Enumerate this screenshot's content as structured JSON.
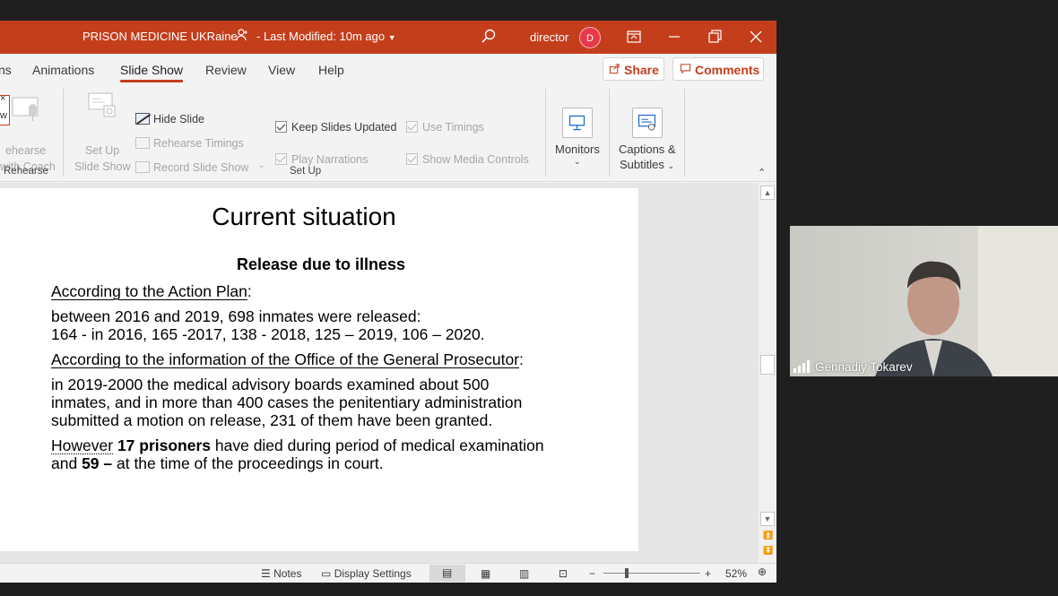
{
  "titlebar": {
    "document_title": "PRISON MEDICINE UKRaine",
    "modified": "-  Last Modified: 10m ago",
    "user": "director",
    "avatar_initial": "D"
  },
  "tabs": {
    "items": [
      {
        "label": "ns"
      },
      {
        "label": "Animations"
      },
      {
        "label": "Slide Show"
      },
      {
        "label": "Review"
      },
      {
        "label": "View"
      },
      {
        "label": "Help"
      }
    ],
    "active": "Slide Show",
    "share": "Share",
    "comments": "Comments"
  },
  "ribbon": {
    "rehearse": {
      "close_glyph": "×",
      "w_glyph": "w",
      "line1": "ehearse",
      "line2": "with Coach",
      "group_label": "Rehearse"
    },
    "setup": {
      "setup_show_line1": "Set Up",
      "setup_show_line2": "Slide Show",
      "hide_slide": "Hide Slide",
      "rehearse_timings": "Rehearse Timings",
      "record_slide_show": "Record Slide Show",
      "keep_slides_updated": "Keep Slides Updated",
      "use_timings": "Use Timings",
      "play_narrations": "Play Narrations",
      "show_media_controls": "Show Media Controls",
      "group_label": "Set Up"
    },
    "monitors": "Monitors",
    "captions_line1": "Captions &",
    "captions_line2": "Subtitles"
  },
  "slide": {
    "title": "Current situation",
    "subtitle": "Release due to illness",
    "p1_heading": "According to the Action Plan",
    "p1_colon": ":",
    "p1_line1": "between 2016 and 2019, 698 inmates were released:",
    "p1_line2": "164 - in 2016, 165 -2017, 138 - 2018, 125 – 2019, 106 – 2020.",
    "p2_heading": "According to the information of the Office of the General Prosecutor",
    "p2_colon": ":",
    "p2_line1": "in 2019-2000 the medical advisory boards examined about 500",
    "p2_line2": "inmates, and in more than 400 cases the penitentiary administration",
    "p2_line3": "submitted a motion on release, 231 of them have been granted.",
    "p3_however": "However",
    "p3_bold1": "17 prisoners",
    "p3_rest1": " have died during period of medical examination",
    "p3_and": "and ",
    "p3_bold2": "59 –",
    "p3_rest2": " at the time of the proceedings in court."
  },
  "statusbar": {
    "notes": "Notes",
    "display_settings": "Display Settings",
    "zoom": "52%",
    "minus": "−",
    "plus": "+"
  },
  "video": {
    "participant": "Gennadiy Tokarev"
  },
  "colors": {
    "accent": "#c43e1c",
    "avatar": "#e8394a"
  }
}
